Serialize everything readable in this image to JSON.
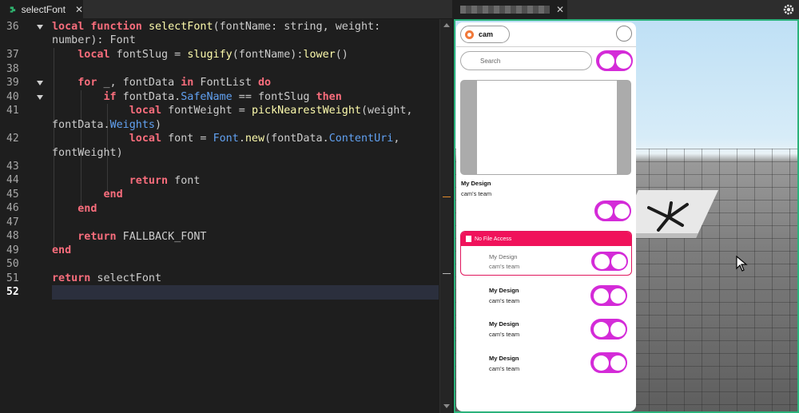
{
  "editor": {
    "tab_label": "selectFont",
    "close_glyph": "✕",
    "line_numbers": [
      "36",
      "37",
      "38",
      "39",
      "40",
      "41",
      "42",
      "43",
      "44",
      "45",
      "46",
      "47",
      "48",
      "49",
      "50",
      "51",
      "52"
    ],
    "active_line": "52"
  },
  "viewport": {
    "close_glyph": "✕"
  },
  "plugin": {
    "user_name": "cam",
    "search_placeholder": "Search",
    "design_title": "My Design",
    "team_name": "cam's team",
    "no_access_label": "No File Access",
    "list_items": [
      {
        "title": "My Design",
        "team": "cam's team"
      },
      {
        "title": "My Design",
        "team": "cam's team"
      },
      {
        "title": "My Design",
        "team": "cam's team"
      },
      {
        "title": "My Design",
        "team": "cam's team"
      }
    ]
  },
  "colors": {
    "keyword": "#f86d7c",
    "function": "#fdfbac",
    "property": "#61a1f1",
    "toggle_accent": "#d42bd8",
    "alert_accent": "#f0125b",
    "viewport_border": "#2bb27b"
  }
}
